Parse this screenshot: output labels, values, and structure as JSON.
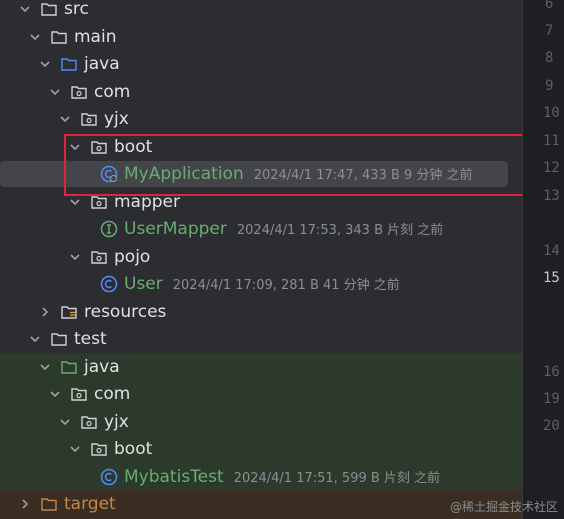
{
  "tree": {
    "src": "src",
    "main": "main",
    "java": "java",
    "com": "com",
    "yjx": "yjx",
    "boot": "boot",
    "my_application": {
      "name": "MyApplication",
      "meta": "2024/4/1 17:47, 433 B 9 分钟 之前"
    },
    "mapper": "mapper",
    "user_mapper": {
      "name": "UserMapper",
      "meta": "2024/4/1 17:53, 343 B 片刻 之前"
    },
    "pojo": "pojo",
    "user": {
      "name": "User",
      "meta": "2024/4/1 17:09, 281 B 41 分钟 之前"
    },
    "resources": "resources",
    "test": "test",
    "test_java": "java",
    "test_com": "com",
    "test_yjx": "yjx",
    "test_boot": "boot",
    "mybatis_test": {
      "name": "MybatisTest",
      "meta": "2024/4/1 17:51, 599 B 片刻 之前"
    },
    "target": "target"
  },
  "gutter": {
    "line_6": "6",
    "line_7": "7",
    "line_8": "8",
    "line_9": "9",
    "line_10": "10",
    "line_11": "11",
    "line_12": "12",
    "line_13": "13",
    "line_14": "14",
    "line_15": "15",
    "line_16": "16",
    "line_19": "19",
    "line_20": "20"
  },
  "watermark": "@稀土掘金技术社区",
  "colors": {
    "background": "#2b2d30",
    "selection": "#43454a",
    "test_background": "#2b3a2b",
    "target_background": "#3a2d22",
    "class_name_green": "#6aab73",
    "highlight_box": "#e0243b",
    "target_orange": "#c5864b"
  }
}
